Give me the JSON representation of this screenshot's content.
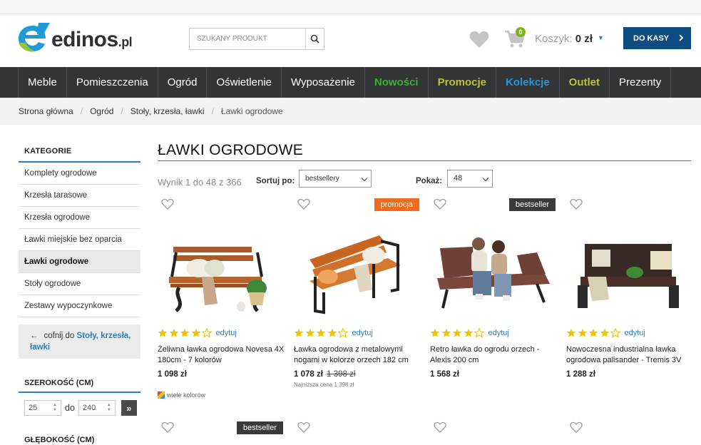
{
  "logo": {
    "name": "edinos",
    "suffix": ".pl"
  },
  "search": {
    "placeholder": "SZUKANY PRODUKT"
  },
  "cart": {
    "count": "0",
    "label": "Koszyk:",
    "value": "0 zł"
  },
  "checkout_label": "DO KASY",
  "nav": [
    {
      "label": "Meble",
      "style": "normal"
    },
    {
      "label": "Pomieszczenia",
      "style": "normal"
    },
    {
      "label": "Ogród",
      "style": "normal"
    },
    {
      "label": "Oświetlenie",
      "style": "normal"
    },
    {
      "label": "Wyposażenie",
      "style": "normal"
    },
    {
      "label": "Nowości",
      "style": "green"
    },
    {
      "label": "Promocje",
      "style": "olive"
    },
    {
      "label": "Kolekcje",
      "style": "blue"
    },
    {
      "label": "Outlet",
      "style": "olive"
    },
    {
      "label": "Prezenty",
      "style": "normal"
    }
  ],
  "breadcrumb": [
    "Strona główna",
    "Ogród",
    "Stoły, krzesła, ławki",
    "Ławki ogrodowe"
  ],
  "sidebar": {
    "heading": "KATEGORIE",
    "items": [
      {
        "label": "Komplety ogrodowe",
        "active": false
      },
      {
        "label": "Krzesła tarasowe",
        "active": false
      },
      {
        "label": "Krzesła ogrodowe",
        "active": false
      },
      {
        "label": "Ławki miejskie bez oparcia",
        "active": false
      },
      {
        "label": "Ławki ogrodowe",
        "active": true
      },
      {
        "label": "Stoły ogrodowe",
        "active": false
      },
      {
        "label": "Zestawy wypoczynkowe",
        "active": false
      }
    ],
    "back_prefix": "cofnij do",
    "back_link": "Stoły, krzesła, ławki",
    "width_filter": {
      "heading": "SZEROKOŚĆ (CM)",
      "from": "25",
      "to_label": "do",
      "to": "240"
    },
    "depth_heading": "GŁĘBOKOŚĆ (CM)"
  },
  "main": {
    "title": "ŁAWKI OGRODOWE",
    "results": "Wynik 1 do 48 z 366",
    "sort_label": "Sortuj po:",
    "sort_value": "bestsellery",
    "show_label": "Pokaż:",
    "show_value": "48"
  },
  "edit_label": "edytuj",
  "products": [
    {
      "name": "Żeliwna ławka ogrodowa Novesa 4X 180cm - 7 kolorów",
      "price": "1 098 zł",
      "old_price": "",
      "lowest": "",
      "badge": "",
      "rating": 4.5,
      "colors_label": "wiele kolorów"
    },
    {
      "name": "Ławka ogrodowa z metalowymi nogami w kolorze orzech 182 cm",
      "price": "1 078 zł",
      "old_price": "1 398 zł",
      "lowest": "Najniższa cena 1 398 zł",
      "badge": "promocja",
      "rating": 4.5,
      "colors_label": ""
    },
    {
      "name": "Retro ławka do ogrodu orzech - Alexis 200 cm",
      "price": "1 568 zł",
      "old_price": "",
      "lowest": "",
      "badge": "bestseller",
      "rating": 4.5,
      "colors_label": ""
    },
    {
      "name": "Nowoczesna industrialna ławka ogrodowa palisander - Tremis 3V",
      "price": "1 288 zł",
      "old_price": "",
      "lowest": "",
      "badge": "",
      "rating": 4.5,
      "colors_label": ""
    }
  ],
  "next_row_badges": [
    "bestseller",
    "",
    "",
    ""
  ],
  "colors": {
    "accent": "#2a7fc0",
    "nav_bg": "#333436",
    "checkout": "#0f4c81",
    "promo": "#f26a1b",
    "star": "#f2c200"
  }
}
